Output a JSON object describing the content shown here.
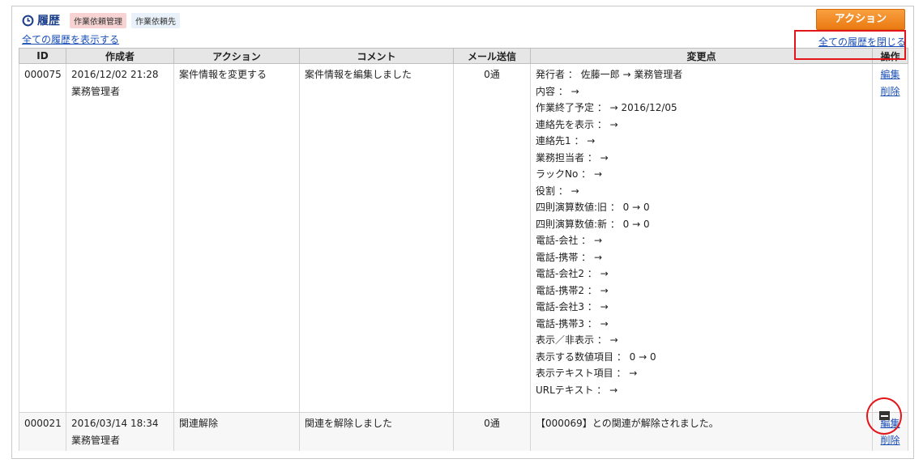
{
  "header": {
    "title": "履歴",
    "tags": [
      "作業依頼管理",
      "作業依頼先"
    ],
    "show_all_label": "全ての履歴を表示する",
    "action_button_label": "アクション",
    "close_all_label": "全ての履歴を閉じる"
  },
  "table": {
    "columns": [
      "ID",
      "作成者",
      "アクション",
      "コメント",
      "メール送信",
      "変更点",
      "操作"
    ],
    "rows": [
      {
        "id": "000075",
        "datetime": "2016/12/02 21:28",
        "author": "業務管理者",
        "action": "案件情報を変更する",
        "comment": "案件情報を編集しました",
        "mail": "0通",
        "changes": [
          "発行者 ： 佐藤一郎 → 業務管理者",
          "内容 ： →",
          "作業終了予定 ： → 2016/12/05",
          "連絡先を表示 ： →",
          "連絡先1 ： →",
          "業務担当者 ： →",
          "ラックNo ： →",
          "役割 ： →",
          "四則演算数値:旧 ： 0 → 0",
          "四則演算数値:新 ： 0 → 0",
          "電話-会社 ： →",
          "電話-携帯 ： →",
          "電話-会社2 ： →",
          "電話-携帯2 ： →",
          "電話-会社3 ： →",
          "電話-携帯3 ： →",
          "表示／非表示 ： →",
          "表示する数値項目 ： 0 → 0",
          "表示テキスト項目 ： →",
          "URLテキスト ： →"
        ],
        "op_edit": "編集",
        "op_delete": "削除"
      },
      {
        "id": "000021",
        "datetime": "2016/03/14 18:34",
        "author": "業務管理者",
        "action": "関連解除",
        "comment": "関連を解除しました",
        "mail": "0通",
        "changes": [
          "【000069】との関連が解除されました。"
        ],
        "op_edit": "編集",
        "op_delete": "削除"
      }
    ]
  },
  "colors": {
    "title": "#1c3f8c",
    "link": "#1a4fb8",
    "action_button": "#ea7a12",
    "highlight": "#e3151a"
  }
}
